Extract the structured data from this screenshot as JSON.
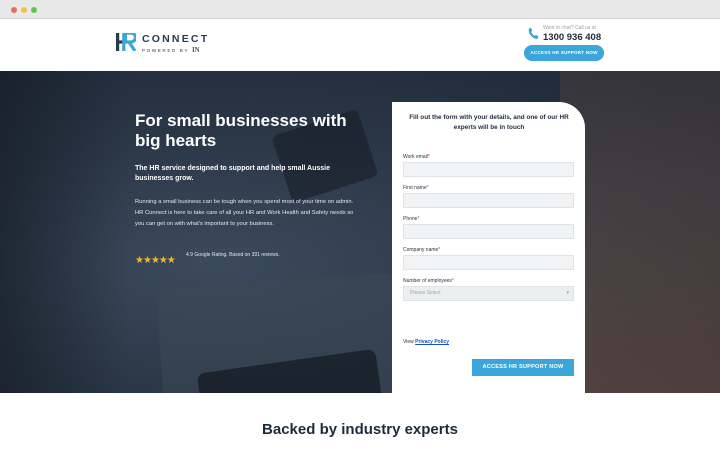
{
  "header": {
    "logo_text": "CONNECT",
    "logo_sub": "POWERED BY",
    "logo_sub_brand": "IN",
    "contact_label": "Want to chat? Call us at",
    "contact_number": "1300 936 408",
    "cta_label": "ACCESS HR SUPPORT NOW"
  },
  "hero": {
    "title": "For small businesses with big hearts",
    "subtitle": "The HR service designed to support and help small Aussie businesses grow.",
    "body": "Running a small business can be tough when you spend most of your time on admin. HR Connect is here to take care of all your HR and Work Health and Safety needs so you can get on with what's important to your business.",
    "stars": [
      "★",
      "★",
      "★",
      "★",
      "★"
    ],
    "rating_text": "4.9 Google Rating. Based on 391 reviews."
  },
  "form": {
    "heading": "Fill out the form with your details, and one of our HR experts will be in touch",
    "fields": [
      {
        "label": "Work email",
        "required": "*"
      },
      {
        "label": "First name",
        "required": "*"
      },
      {
        "label": "Phone",
        "required": "*"
      },
      {
        "label": "Company name",
        "required": "*"
      },
      {
        "label": "Number of employees",
        "required": "*"
      }
    ],
    "select_placeholder": "Please Select",
    "privacy_prefix": "View",
    "privacy_link": "Privacy Policy",
    "submit_label": "ACCESS HR SUPPORT NOW"
  },
  "section": {
    "title": "Backed by industry experts"
  },
  "colors": {
    "accent": "#3aa6d9",
    "navy": "#1e2b3c",
    "star": "#f5b624"
  }
}
